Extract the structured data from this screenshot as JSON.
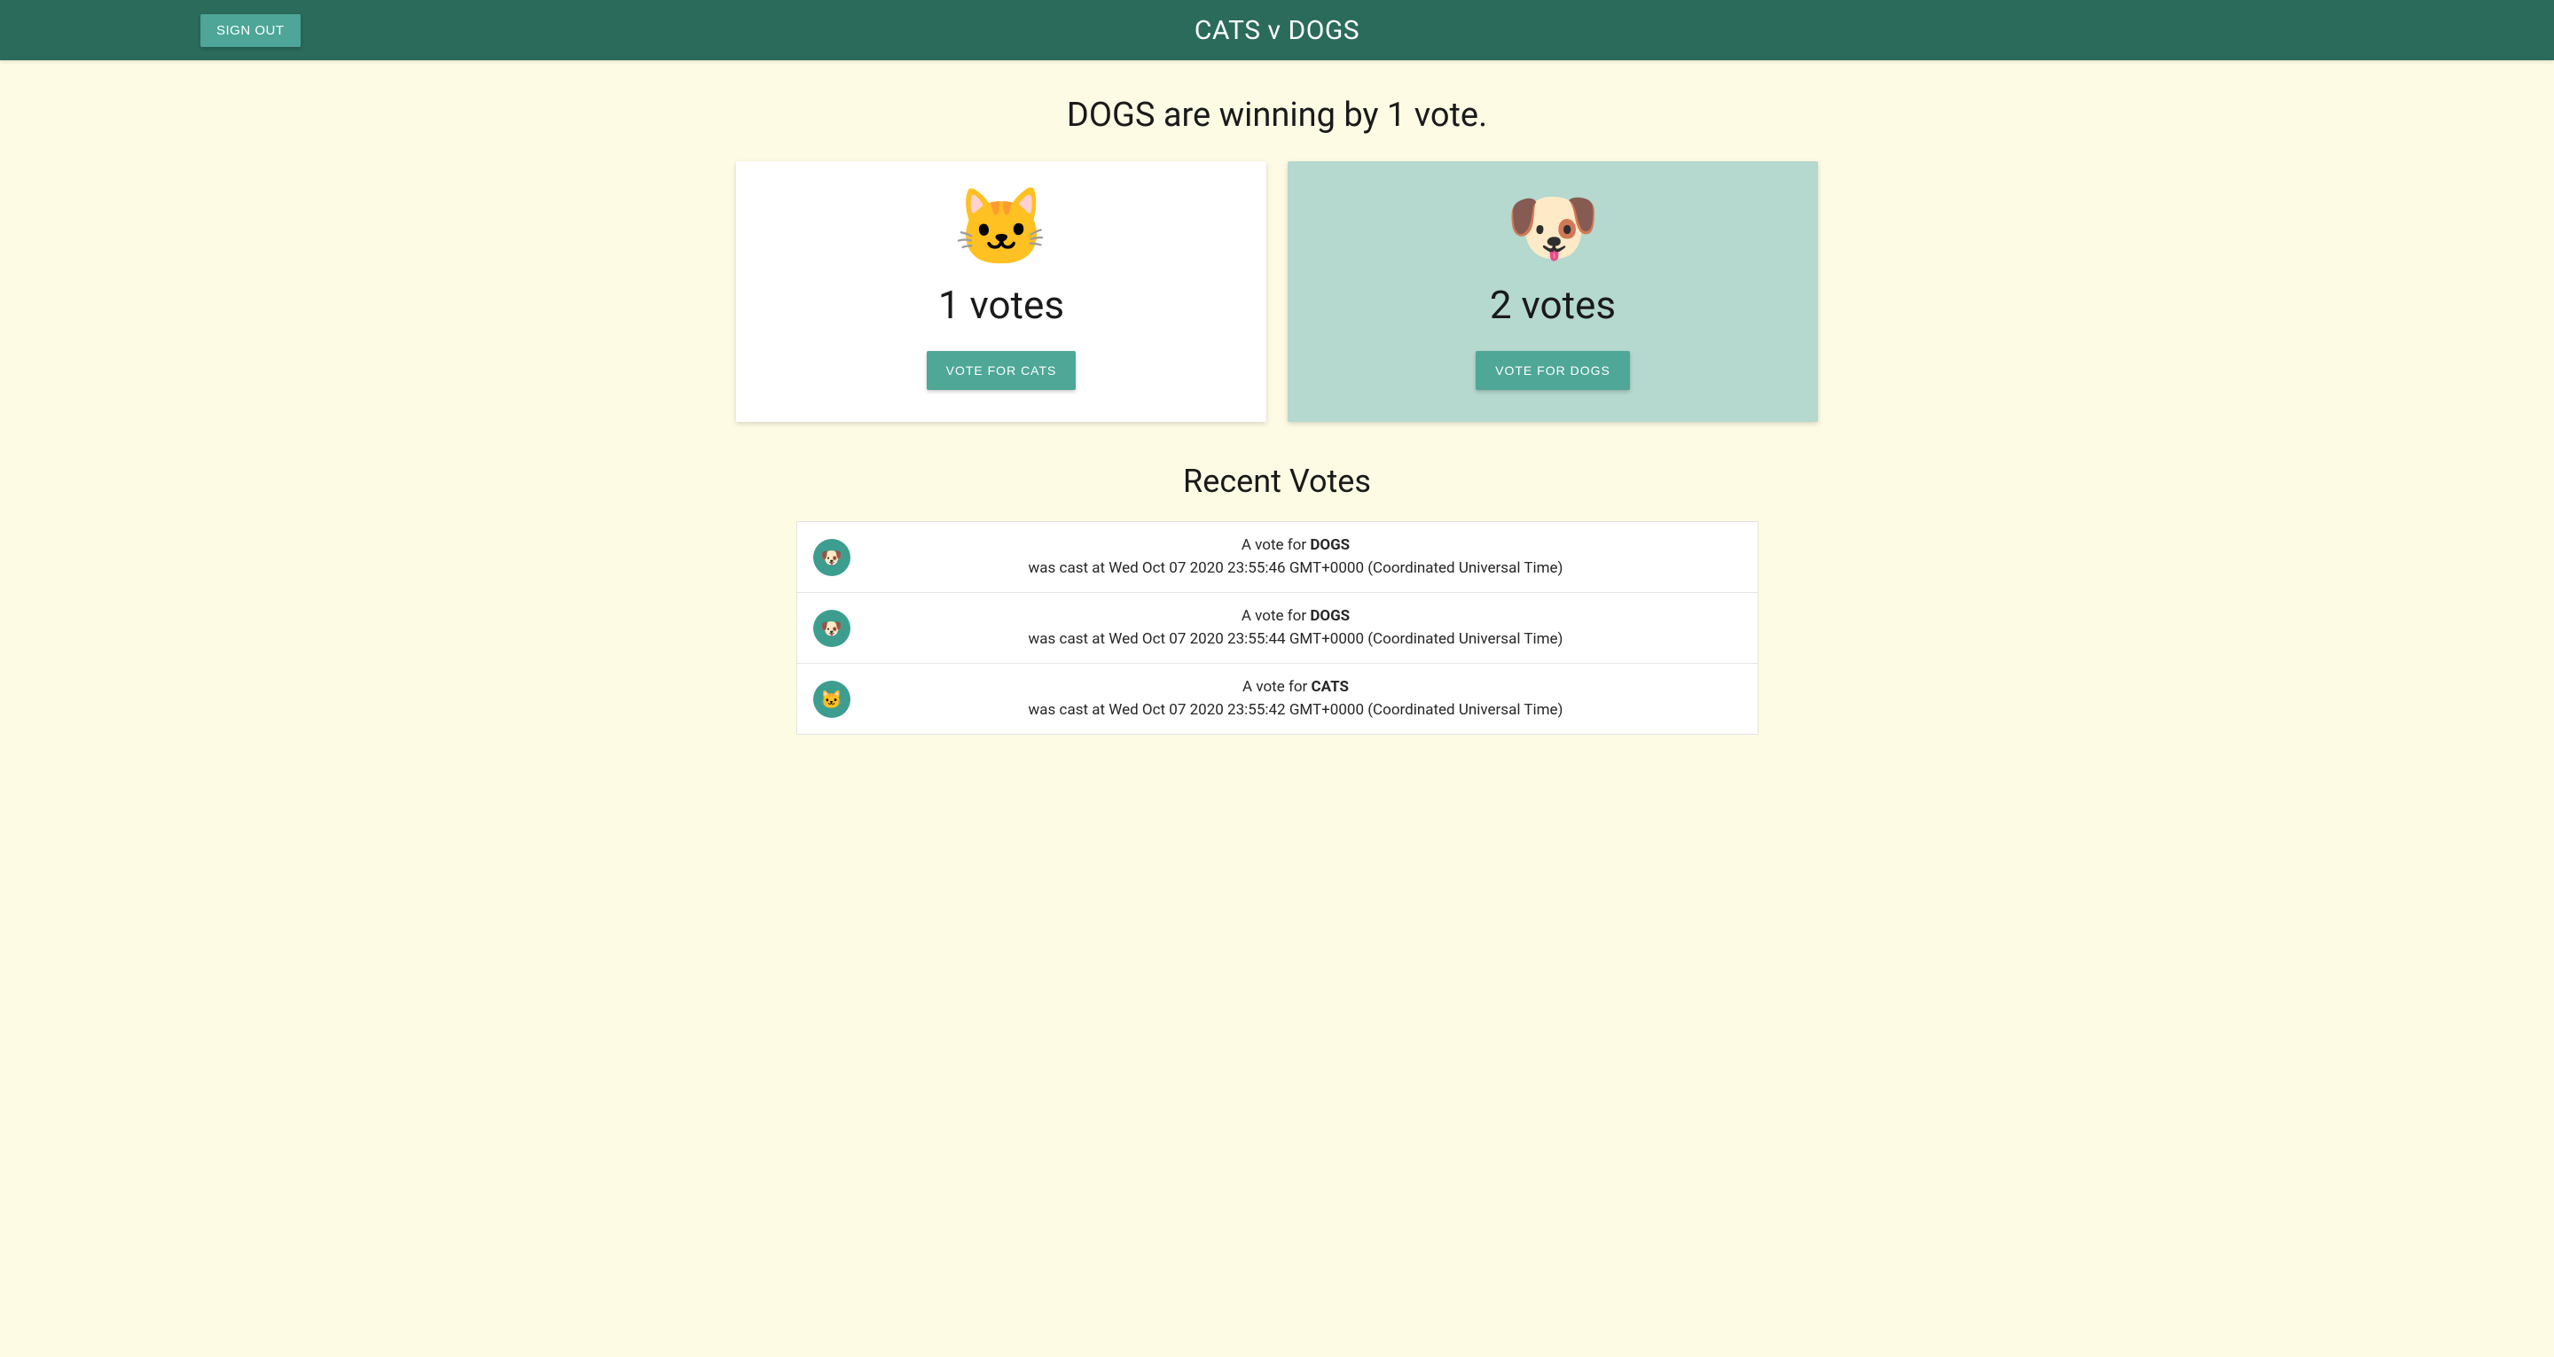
{
  "header": {
    "sign_out_label": "SIGN OUT",
    "title": "CATS v DOGS"
  },
  "main": {
    "winning_text": "DOGS are winning by 1 vote.",
    "cats": {
      "emoji": "🐱",
      "votes_text": "1 votes",
      "button_label": "VOTE FOR CATS"
    },
    "dogs": {
      "emoji": "🐶",
      "votes_text": "2 votes",
      "button_label": "VOTE FOR DOGS"
    }
  },
  "recent": {
    "heading": "Recent Votes",
    "vote_prefix": "A vote for ",
    "cast_prefix": "was cast at ",
    "items": [
      {
        "emoji": "🐶",
        "target": "DOGS",
        "timestamp": "Wed Oct 07 2020 23:55:46 GMT+0000 (Coordinated Universal Time)"
      },
      {
        "emoji": "🐶",
        "target": "DOGS",
        "timestamp": "Wed Oct 07 2020 23:55:44 GMT+0000 (Coordinated Universal Time)"
      },
      {
        "emoji": "🐱",
        "target": "CATS",
        "timestamp": "Wed Oct 07 2020 23:55:42 GMT+0000 (Coordinated Universal Time)"
      }
    ]
  }
}
